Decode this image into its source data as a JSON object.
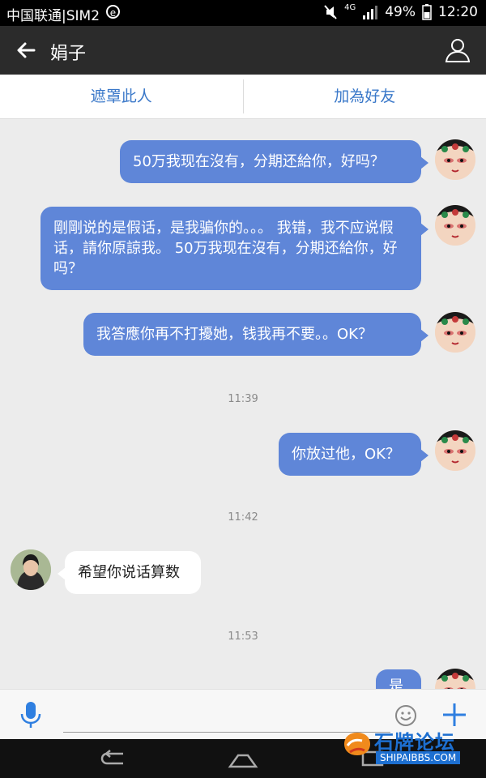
{
  "status_bar": {
    "carrier": "中国联通|SIM2",
    "network": "4G",
    "battery": "49%",
    "time": "12:20"
  },
  "app_bar": {
    "title": "娟子"
  },
  "actions": {
    "block": "遮罩此人",
    "add_friend": "加為好友"
  },
  "messages": [
    {
      "side": "out",
      "text": "50万我现在沒有，分期还給你，好吗？"
    },
    {
      "side": "out",
      "text": "剛剛说的是假话，是我骗你的。。。 我错，我不应说假话，請你原諒我。 50万我现在沒有，分期还給你，好吗？"
    },
    {
      "side": "out",
      "text": "我答應你再不打擾她，钱我再不要。。OK？"
    },
    {
      "side": "time",
      "text": "11:39"
    },
    {
      "side": "out",
      "text": "你放过他，OK？"
    },
    {
      "side": "time",
      "text": "11:42"
    },
    {
      "side": "in",
      "text": "希望你说话算数"
    },
    {
      "side": "time",
      "text": "11:53"
    },
    {
      "side": "out",
      "text": "是"
    }
  ],
  "input": {
    "placeholder": ""
  },
  "watermark": {
    "title": "石牌论坛",
    "url": "SHIPAIBBS.COM"
  },
  "colors": {
    "bubble_out": "#5f86d8",
    "bubble_in": "#ffffff",
    "accent": "#3a78c9",
    "appbar": "#2b2b2b"
  },
  "icons": [
    "mute-icon",
    "signal-icon",
    "battery-icon",
    "back-arrow-icon",
    "profile-icon",
    "mic-icon",
    "emoji-icon",
    "plus-icon",
    "nav-back-icon",
    "nav-home-icon",
    "nav-recents-icon"
  ]
}
